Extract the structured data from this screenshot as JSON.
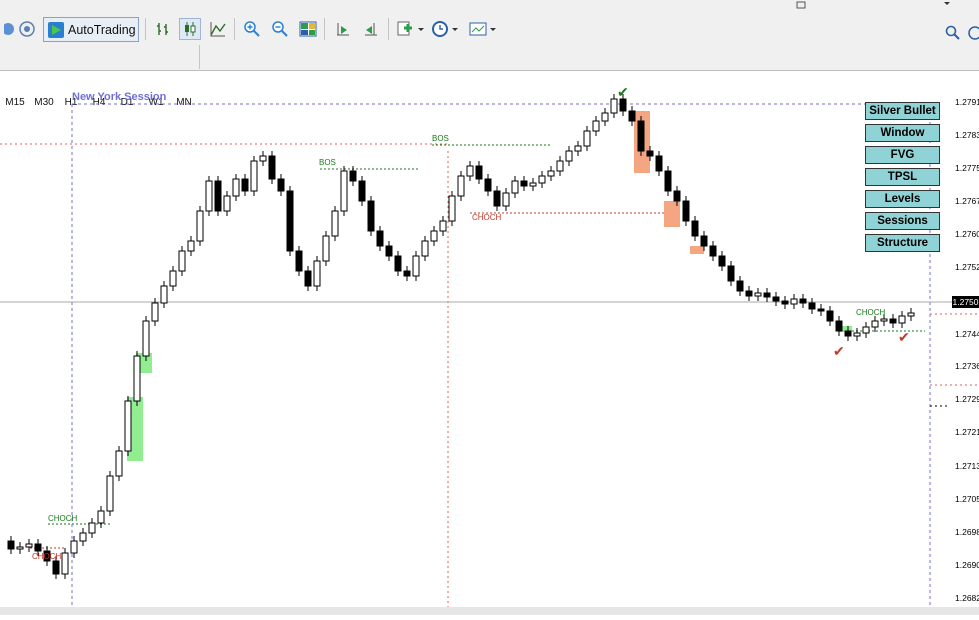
{
  "toolbar": {
    "autotrading_label": "AutoTrading",
    "icons_left": [
      "chat-icon",
      "signal-icon"
    ],
    "icons_right": [
      "bar-chart-icon",
      "candlestick-icon",
      "line-chart-icon",
      "zoom-in-icon",
      "zoom-out-icon",
      "tile-windows-icon",
      "autoscroll-icon",
      "chart-shift-icon",
      "add-indicator-icon",
      "period-clock-icon",
      "templates-icon"
    ],
    "search_icon": "search-icon"
  },
  "timeframes": [
    "M15",
    "M30",
    "H1",
    "H4",
    "D1",
    "W1",
    "MN"
  ],
  "chart": {
    "session_label": "New York Session",
    "panel_buttons": [
      "Silver Bullet",
      "Window",
      "FVG",
      "TPSL",
      "Levels",
      "Sessions",
      "Structure"
    ],
    "price_ticks": [
      "1.2791",
      "1.2783",
      "1.2775",
      "1.2767",
      "1.2760",
      "1.2752",
      "1.2744",
      "1.2736",
      "1.2729",
      "1.2721",
      "1.2713",
      "1.2705",
      "1.2698",
      "1.2690",
      "1.2682"
    ],
    "current_price": "1.2750",
    "structure_labels": {
      "bos_1": "BOS",
      "bos_2": "BOS",
      "choch_top_left": "CHOCH",
      "choch_bottom_left": "CHOCH",
      "choch_mid": "CHOCH",
      "choch_right": "CHOCH"
    },
    "colors": {
      "bull_fvg": "#90ee90",
      "bear_fvg": "#f4a582",
      "session_line": "#6f6fd6",
      "bos_line": "#1a7a1a",
      "choch_line": "#c0392b"
    }
  }
}
